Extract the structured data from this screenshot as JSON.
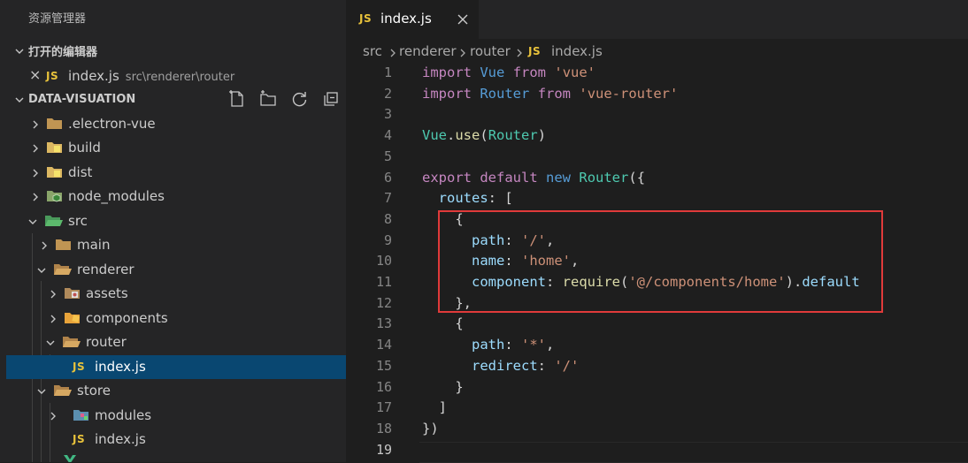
{
  "sidebar": {
    "title": "资源管理器",
    "open_editors": {
      "header": "打开的编辑器",
      "items": [
        {
          "close": "×",
          "badge": "JS",
          "name": "index.js",
          "path": "src\\renderer\\router"
        }
      ]
    },
    "project": {
      "header": "DATA-VISUATION",
      "actions": [
        "new-file-icon",
        "new-folder-icon",
        "refresh-icon",
        "collapse-all-icon"
      ]
    },
    "tree": [
      {
        "name": ".electron-vue",
        "icon": "folder-icon",
        "expanded": false
      },
      {
        "name": "build",
        "icon": "folder-icon",
        "expanded": false
      },
      {
        "name": "dist",
        "icon": "folder-icon",
        "expanded": false
      },
      {
        "name": "node_modules",
        "icon": "node-folder-icon",
        "expanded": false
      },
      {
        "name": "src",
        "icon": "src-folder-icon",
        "expanded": true
      },
      {
        "name": "main",
        "icon": "folder-icon",
        "expanded": false
      },
      {
        "name": "renderer",
        "icon": "folder-open-icon",
        "expanded": true
      },
      {
        "name": "assets",
        "icon": "assets-folder-icon",
        "expanded": false
      },
      {
        "name": "components",
        "icon": "components-folder-icon",
        "expanded": false
      },
      {
        "name": "router",
        "icon": "folder-open-icon",
        "expanded": true
      },
      {
        "name": "index.js",
        "icon": "js-file-icon",
        "selected": true
      },
      {
        "name": "store",
        "icon": "folder-open-icon",
        "expanded": true
      },
      {
        "name": "modules",
        "icon": "modules-folder-icon",
        "expanded": false
      },
      {
        "name": "index.js",
        "icon": "js-file-icon"
      }
    ]
  },
  "editor": {
    "tab": {
      "badge": "JS",
      "label": "index.js",
      "close": "×"
    },
    "breadcrumb": [
      "src",
      "renderer",
      "router",
      "index.js"
    ],
    "breadcrumb_badge": "JS",
    "line_numbers": [
      "1",
      "2",
      "3",
      "4",
      "5",
      "6",
      "7",
      "8",
      "9",
      "10",
      "11",
      "12",
      "13",
      "14",
      "15",
      "16",
      "17",
      "18",
      "19"
    ],
    "active_line": "19",
    "lines": [
      {
        "tokens": [
          [
            "kw",
            "import"
          ],
          [
            "t",
            " "
          ],
          [
            "kb",
            "Vue"
          ],
          [
            "t",
            " "
          ],
          [
            "kw",
            "from"
          ],
          [
            "t",
            " "
          ],
          [
            "str",
            "'vue'"
          ]
        ]
      },
      {
        "tokens": [
          [
            "kw",
            "import"
          ],
          [
            "t",
            " "
          ],
          [
            "kb",
            "Router"
          ],
          [
            "t",
            " "
          ],
          [
            "kw",
            "from"
          ],
          [
            "t",
            " "
          ],
          [
            "str",
            "'vue-router'"
          ]
        ]
      },
      {
        "tokens": []
      },
      {
        "tokens": [
          [
            "cls",
            "Vue"
          ],
          [
            "t",
            "."
          ],
          [
            "fn",
            "use"
          ],
          [
            "t",
            "("
          ],
          [
            "cls",
            "Router"
          ],
          [
            "t",
            ")"
          ]
        ]
      },
      {
        "tokens": []
      },
      {
        "tokens": [
          [
            "kw",
            "export"
          ],
          [
            "t",
            " "
          ],
          [
            "kw",
            "default"
          ],
          [
            "t",
            " "
          ],
          [
            "kb",
            "new"
          ],
          [
            "t",
            " "
          ],
          [
            "cls",
            "Router"
          ],
          [
            "t",
            "({"
          ]
        ]
      },
      {
        "tokens": [
          [
            "t",
            "  "
          ],
          [
            "prop",
            "routes"
          ],
          [
            "t",
            ": ["
          ]
        ]
      },
      {
        "tokens": [
          [
            "t",
            "    {"
          ]
        ]
      },
      {
        "tokens": [
          [
            "t",
            "      "
          ],
          [
            "prop",
            "path"
          ],
          [
            "t",
            ": "
          ],
          [
            "str",
            "'/'"
          ],
          [
            "t",
            ","
          ]
        ]
      },
      {
        "tokens": [
          [
            "t",
            "      "
          ],
          [
            "prop",
            "name"
          ],
          [
            "t",
            ": "
          ],
          [
            "str",
            "'home'"
          ],
          [
            "t",
            ","
          ]
        ]
      },
      {
        "tokens": [
          [
            "t",
            "      "
          ],
          [
            "prop",
            "component"
          ],
          [
            "t",
            ": "
          ],
          [
            "fn",
            "require"
          ],
          [
            "t",
            "("
          ],
          [
            "str",
            "'@/components/home'"
          ],
          [
            "t",
            ")."
          ],
          [
            "prop",
            "default"
          ]
        ]
      },
      {
        "tokens": [
          [
            "t",
            "    },"
          ]
        ]
      },
      {
        "tokens": [
          [
            "t",
            "    {"
          ]
        ]
      },
      {
        "tokens": [
          [
            "t",
            "      "
          ],
          [
            "prop",
            "path"
          ],
          [
            "t",
            ": "
          ],
          [
            "str",
            "'*'"
          ],
          [
            "t",
            ","
          ]
        ]
      },
      {
        "tokens": [
          [
            "t",
            "      "
          ],
          [
            "prop",
            "redirect"
          ],
          [
            "t",
            ": "
          ],
          [
            "str",
            "'/'"
          ]
        ]
      },
      {
        "tokens": [
          [
            "t",
            "    }"
          ]
        ]
      },
      {
        "tokens": [
          [
            "t",
            "  ]"
          ]
        ]
      },
      {
        "tokens": [
          [
            "t",
            "})"
          ]
        ]
      },
      {
        "tokens": []
      }
    ]
  },
  "colors": {
    "sidebar_bg": "#252526",
    "editor_bg": "#1e1e1e",
    "selection": "#094771",
    "highlight_box": "#e03a3a",
    "js_badge": "#e8c23b"
  }
}
